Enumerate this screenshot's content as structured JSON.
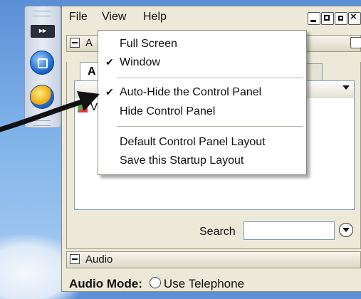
{
  "dock": {
    "buttons": [
      "fast-forward",
      "stop",
      "share"
    ]
  },
  "menubar": {
    "file": "File",
    "view": "View",
    "help": "Help"
  },
  "panels": {
    "top_title": "A",
    "tab_label": "A",
    "list_first_row": "V",
    "search_label": "Search",
    "search_value": "",
    "audio_title": "Audio",
    "audio_mode_label": "Audio Mode:",
    "audio_mode_option": "Use Telephone"
  },
  "view_menu": {
    "items": [
      {
        "label": "Full Screen",
        "checked": false
      },
      {
        "label": "Window",
        "checked": true
      },
      {
        "label": "Auto-Hide the Control Panel",
        "checked": true
      },
      {
        "label": "Hide Control Panel",
        "checked": false
      },
      {
        "label": "Default Control Panel Layout",
        "checked": false
      },
      {
        "label": "Save this Startup Layout",
        "checked": false
      }
    ],
    "check_glyph": "✔"
  },
  "colors": {
    "menu_bg": "#ffffff",
    "window_bg": "#ece9d8",
    "annotation_arrow": "#111111"
  }
}
